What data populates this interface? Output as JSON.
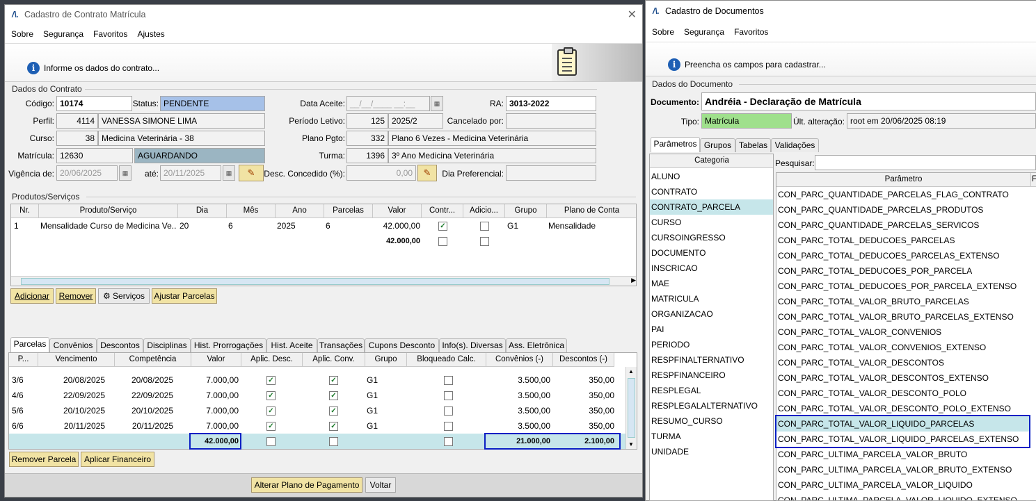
{
  "left": {
    "title": "Cadastro de Contrato Matrícula",
    "menu": [
      "Sobre",
      "Segurança",
      "Favoritos",
      "Ajustes"
    ],
    "info": "Informe os dados do contrato...",
    "section_contract": "Dados do Contrato",
    "fields": {
      "codigo_label": "Código:",
      "codigo": "10174",
      "status_label": "Status:",
      "status": "PENDENTE",
      "data_aceite_label": "Data Aceite:",
      "data_aceite": "__/__/____ __:__",
      "ra_label": "RA:",
      "ra": "3013-2022",
      "perfil_label": "Perfil:",
      "perfil_id": "4114",
      "perfil_nome": "VANESSA SIMONE LIMA",
      "periodo_label": "Período Letivo:",
      "periodo_id": "125",
      "periodo": "2025/2",
      "cancelado_label": "Cancelado por:",
      "curso_label": "Curso:",
      "curso_id": "38",
      "curso": "Medicina Veterinária - 38",
      "plano_label": "Plano Pgto:",
      "plano_id": "332",
      "plano": "Plano 6 Vezes - Medicina Veterinária",
      "matricula_label": "Matrícula:",
      "matricula": "12630",
      "matricula_status": "AGUARDANDO",
      "turma_label": "Turma:",
      "turma_id": "1396",
      "turma": "3º Ano Medicina Veterinária",
      "vigencia_label": "Vigência de:",
      "vigencia_de": "20/06/2025",
      "ate_label": "até:",
      "vigencia_ate": "20/11/2025",
      "desc_label": "Desc. Concedido (%):",
      "desc": "0,00",
      "dia_pref_label": "Dia Preferencial:"
    },
    "section_products": "Produtos/Serviços",
    "products": {
      "headers": [
        "Nr.",
        "Produto/Serviço",
        "Dia",
        "Mês",
        "Ano",
        "Parcelas",
        "Valor",
        "Contr...",
        "Adicio...",
        "Grupo",
        "Plano de Conta"
      ],
      "row": {
        "nr": "1",
        "produto": "Mensalidade Curso de Medicina Ve...",
        "dia": "20",
        "mes": "6",
        "ano": "2025",
        "parcelas": "6",
        "valor": "42.000,00",
        "grupo": "G1",
        "plano": "Mensalidade"
      },
      "total": "42.000,00"
    },
    "buttons": {
      "adicionar": "Adicionar",
      "remover": "Remover",
      "servicos": "Serviços",
      "ajustar": "Ajustar Parcelas",
      "remover_parcela": "Remover Parcela",
      "aplicar": "Aplicar Financeiro",
      "alterar": "Alterar Plano de Pagamento",
      "voltar": "Voltar"
    },
    "tabs": [
      "Parcelas",
      "Convênios",
      "Descontos",
      "Disciplinas",
      "Hist. Prorrogações",
      "Hist. Aceite",
      "Transações",
      "Cupons Desconto",
      "Info(s). Diversas",
      "Ass. Eletrônica"
    ],
    "parcelas": {
      "headers": [
        "P...",
        "Vencimento",
        "Competência",
        "Valor",
        "Aplic. Desc.",
        "Aplic. Conv.",
        "Grupo",
        "Bloqueado Calc.",
        "Convênios (-)",
        "Descontos (-)"
      ],
      "rows": [
        {
          "p": "3/6",
          "venc": "20/08/2025",
          "comp": "20/08/2025",
          "valor": "7.000,00",
          "grupo": "G1",
          "conv": "3.500,00",
          "desc": "350,00"
        },
        {
          "p": "4/6",
          "venc": "22/09/2025",
          "comp": "22/09/2025",
          "valor": "7.000,00",
          "grupo": "G1",
          "conv": "3.500,00",
          "desc": "350,00"
        },
        {
          "p": "5/6",
          "venc": "20/10/2025",
          "comp": "20/10/2025",
          "valor": "7.000,00",
          "grupo": "G1",
          "conv": "3.500,00",
          "desc": "350,00"
        },
        {
          "p": "6/6",
          "venc": "20/11/2025",
          "comp": "20/11/2025",
          "valor": "7.000,00",
          "grupo": "G1",
          "conv": "3.500,00",
          "desc": "350,00"
        }
      ],
      "total_valor": "42.000,00",
      "total_conv": "21.000,00",
      "total_desc": "2.100,00"
    }
  },
  "right": {
    "title": "Cadastro de Documentos",
    "menu": [
      "Sobre",
      "Segurança",
      "Favoritos"
    ],
    "info": "Preencha os campos para cadastrar...",
    "section": "Dados do Documento",
    "documento_label": "Documento:",
    "documento": "Andréia - Declaração de Matrícula",
    "tipo_label": "Tipo:",
    "tipo": "Matrícula",
    "ult_label": "Últ. alteração:",
    "ult": "root em 20/06/2025 08:19",
    "tabs": [
      "Parâmetros",
      "Grupos",
      "Tabelas",
      "Validações"
    ],
    "categoria_header": "Categoria",
    "categorias": [
      "ALUNO",
      "CONTRATO",
      "CONTRATO_PARCELA",
      "CURSO",
      "CURSOINGRESSO",
      "DOCUMENTO",
      "INSCRICAO",
      "MAE",
      "MATRICULA",
      "ORGANIZACAO",
      "PAI",
      "PERIODO",
      "RESPFINALTERNATIVO",
      "RESPFINANCEIRO",
      "RESPLEGAL",
      "RESPLEGALALTERNATIVO",
      "RESUMO_CURSO",
      "TURMA",
      "UNIDADE"
    ],
    "pesquisar_label": "Pesquisar:",
    "parametro_header": "Parâmetro",
    "param_header2": "F",
    "parametros": [
      "CON_PARC_QUANTIDADE_PARCELAS_FLAG_CONTRATO",
      "CON_PARC_QUANTIDADE_PARCELAS_PRODUTOS",
      "CON_PARC_QUANTIDADE_PARCELAS_SERVICOS",
      "CON_PARC_TOTAL_DEDUCOES_PARCELAS",
      "CON_PARC_TOTAL_DEDUCOES_PARCELAS_EXTENSO",
      "CON_PARC_TOTAL_DEDUCOES_POR_PARCELA",
      "CON_PARC_TOTAL_DEDUCOES_POR_PARCELA_EXTENSO",
      "CON_PARC_TOTAL_VALOR_BRUTO_PARCELAS",
      "CON_PARC_TOTAL_VALOR_BRUTO_PARCELAS_EXTENSO",
      "CON_PARC_TOTAL_VALOR_CONVENIOS",
      "CON_PARC_TOTAL_VALOR_CONVENIOS_EXTENSO",
      "CON_PARC_TOTAL_VALOR_DESCONTOS",
      "CON_PARC_TOTAL_VALOR_DESCONTOS_EXTENSO",
      "CON_PARC_TOTAL_VALOR_DESCONTO_POLO",
      "CON_PARC_TOTAL_VALOR_DESCONTO_POLO_EXTENSO",
      "CON_PARC_TOTAL_VALOR_LIQUIDO_PARCELAS",
      "CON_PARC_TOTAL_VALOR_LIQUIDO_PARCELAS_EXTENSO",
      "CON_PARC_ULTIMA_PARCELA_VALOR_BRUTO",
      "CON_PARC_ULTIMA_PARCELA_VALOR_BRUTO_EXTENSO",
      "CON_PARC_ULTIMA_PARCELA_VALOR_LIQUIDO",
      "CON_PARC_ULTIMA_PARCELA_VALOR_LIQUIDO_EXTENSO"
    ]
  }
}
